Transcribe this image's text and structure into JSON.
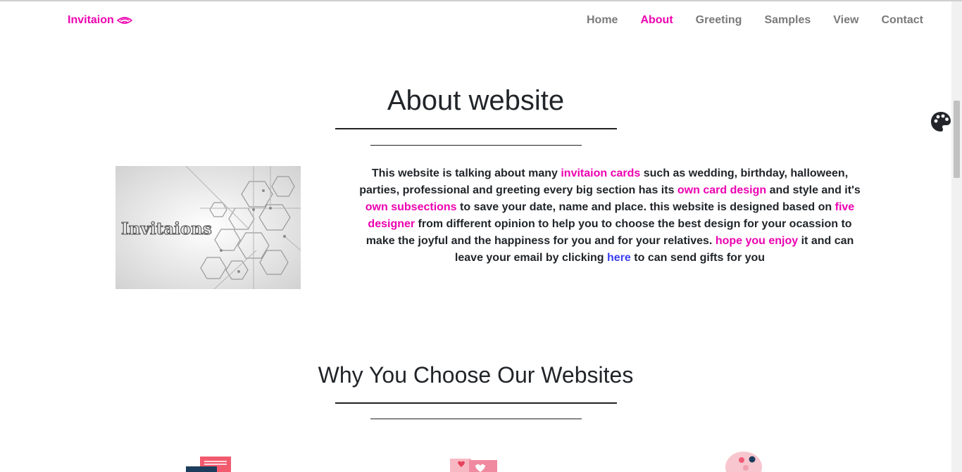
{
  "brand": {
    "name": "Invitaion",
    "icon": "eye-wave-icon",
    "color": "#ec01b0"
  },
  "nav": {
    "items": [
      {
        "label": "Home",
        "active": false
      },
      {
        "label": "About",
        "active": true
      },
      {
        "label": "Greeting",
        "active": false
      },
      {
        "label": "Samples",
        "active": false
      },
      {
        "label": "View",
        "active": false
      },
      {
        "label": "Contact",
        "active": false
      }
    ]
  },
  "about": {
    "title": "About website",
    "image_text": "Invitaions",
    "text": {
      "p1": "This website is talking about many ",
      "h1": "invitaion cards",
      "p2": " such as wedding, birthday, halloween, parties, professional and greeting every big section has its ",
      "h2": "own card design",
      "p3": " and style and it's ",
      "h3": "own subsections",
      "p4": " to save your date, name and place. this website is designed based on ",
      "h4": "five designer",
      "p5": " from different opinion to help you to choose the best design for your ocassion to make the joyful and the happiness for you and for your relatives. ",
      "h5": "hope you enjoy",
      "p6": " it and can leave your email by clicking ",
      "link": "here",
      "p7": " to can send gifts for you"
    }
  },
  "why": {
    "title": "Why You Choose Our Websites"
  },
  "features": [
    {
      "icon": "envelope-card-icon"
    },
    {
      "icon": "heart-card-icon"
    },
    {
      "icon": "palette-art-icon"
    }
  ],
  "theme_toggle": {
    "icon": "palette-icon"
  },
  "colors": {
    "accent": "#ec01b0",
    "link": "#3a3ef0",
    "nav_text": "#7a7a7a"
  }
}
